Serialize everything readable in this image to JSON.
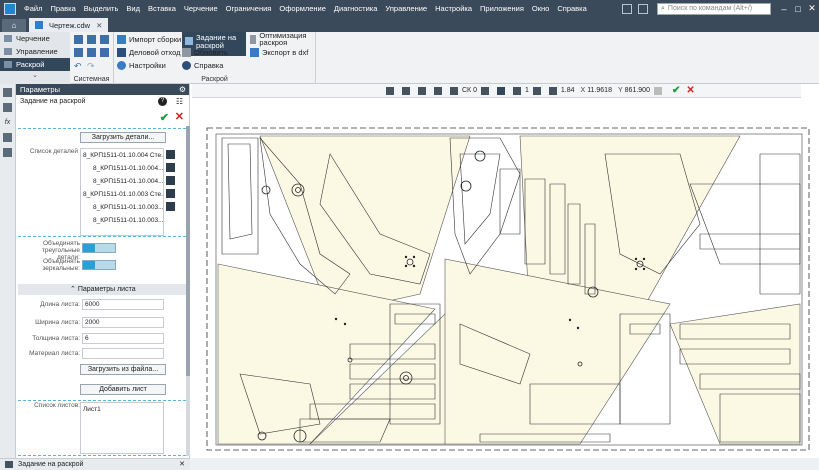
{
  "menu": [
    "Файл",
    "Правка",
    "Выделить",
    "Вид",
    "Вставка",
    "Черчение",
    "Ограничения",
    "Оформление",
    "Диагностика",
    "Управление",
    "Настройка",
    "Приложения",
    "Окно",
    "Справка"
  ],
  "search": {
    "placeholder": "Поиск по командам (Alt+/)"
  },
  "tabs": {
    "doc": "Чертеж.cdw"
  },
  "modes": [
    "Черчение",
    "Управление",
    "Раскрой"
  ],
  "ribbon": {
    "system_label": "Системная",
    "import_label": "Импорт сборки",
    "deal_label": "Деловой отход",
    "settings_label": "Настройки",
    "task_label": "Задание на раскрой",
    "update_label": "Обновить",
    "help_label": "Справка",
    "optimize_label": "Оптимизация раскроя",
    "export_label": "Экспорт в dxf",
    "raskroy_group": "Раскрой"
  },
  "panel": {
    "title": "Параметры",
    "task_title": "Задание на раскрой",
    "load_details": "Загрузить детали...",
    "details_label": "Список деталей",
    "details": [
      "8_КРП1511-01.10.004 Сте...",
      "8_КРП1511-01.10.004...",
      "8_КРП1511-01.10.004...",
      "8_КРП1511-01.10.003 Сте...",
      "8_КРП1511-01.10.003...",
      "8_КРП1511-01.10.003..."
    ],
    "merge_tri_label": "Объединять треугольные детали:",
    "merge_mirror_label": "Объединять зеркальные:",
    "sheet_params": "Параметры листа",
    "length_label": "Длина листа:",
    "length_value": "6000",
    "width_label": "Ширина листа:",
    "width_value": "2000",
    "thick_label": "Толщина листа:",
    "thick_value": "6",
    "material_label": "Материал листа:",
    "material_value": "",
    "load_file": "Загрузить из файла...",
    "add_sheet": "Добавить лист",
    "sheets_label": "Список листов:",
    "sheets": [
      "Лист1"
    ]
  },
  "status": {
    "text": "Задание на раскрой"
  },
  "viewtool": {
    "cs": "СК 0",
    "step": "1",
    "zoom": "1.84",
    "x_label": "X",
    "x": "11.9618",
    "y_label": "Y",
    "y": "861.900"
  }
}
